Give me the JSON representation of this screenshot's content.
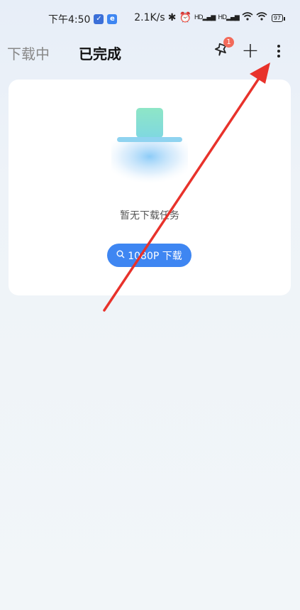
{
  "status_bar": {
    "time": "下午4:50",
    "speed": "2.1K/s",
    "signal1": "HD",
    "signal2": "HD",
    "battery": "97"
  },
  "header": {
    "tab_downloading": "下载中",
    "tab_completed": "已完成",
    "badge_count": "1",
    "plus_symbol": "+"
  },
  "empty_state": {
    "message": "暂无下载任务",
    "button_label": "1080P 下载"
  },
  "colors": {
    "accent": "#3e86f2",
    "badge": "#f26a5a",
    "annotation": "#e8322b"
  }
}
